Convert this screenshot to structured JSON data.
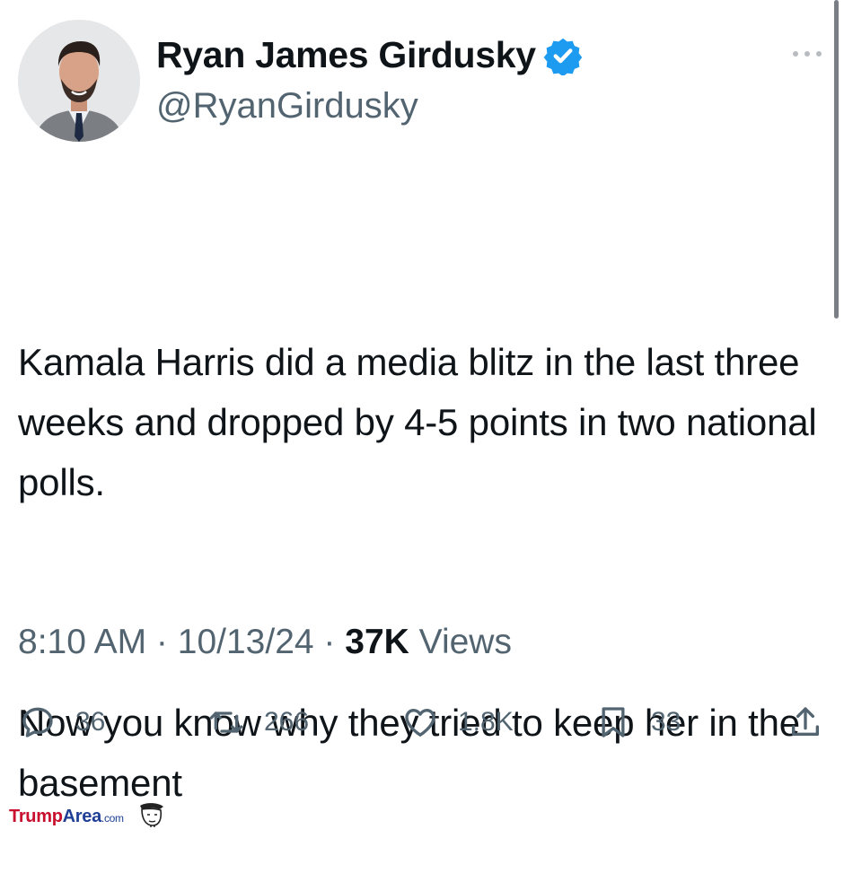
{
  "author": {
    "display_name": "Ryan James Girdusky",
    "handle": "@RyanGirdusky",
    "verified_icon": "verified-badge-icon",
    "colors": {
      "verified": "#1d9bf0"
    }
  },
  "tweet": {
    "paragraphs": [
      "Kamala Harris did a media blitz in the last three weeks and dropped by 4-5 points in two national polls.",
      "Now you know why they tried to keep her in the basement"
    ]
  },
  "meta": {
    "time": "8:10 AM",
    "separator": " · ",
    "date": "10/13/24",
    "views_count": "37K",
    "views_label": " Views"
  },
  "actions": {
    "reply": {
      "icon": "reply-icon",
      "count": "36"
    },
    "retweet": {
      "icon": "retweet-icon",
      "count": "266"
    },
    "like": {
      "icon": "heart-icon",
      "count": "1.8K"
    },
    "bookmark": {
      "icon": "bookmark-icon",
      "count": "33"
    },
    "share": {
      "icon": "share-icon"
    }
  },
  "watermark": {
    "part1": "Trump",
    "part2": "Area",
    "part3": ".com"
  },
  "colors": {
    "text": "#0f1419",
    "secondary": "#536471",
    "brand_red": "#c8102e",
    "brand_blue": "#1f3f96"
  }
}
